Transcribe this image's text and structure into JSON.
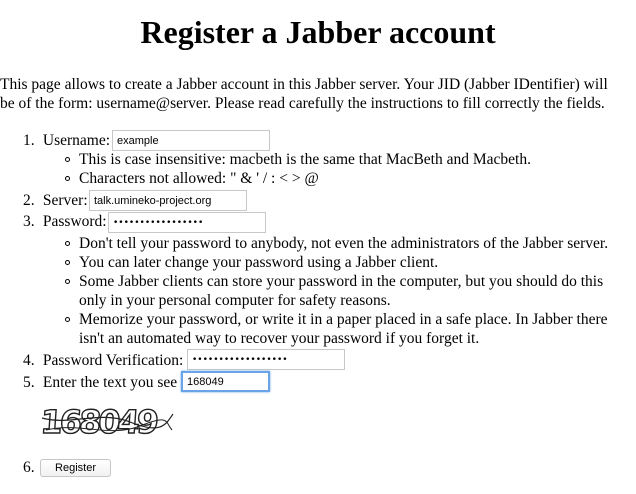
{
  "heading": "Register a Jabber account",
  "intro": {
    "line1": "This page allows to create a Jabber account in this Jabber server. Your JID (Jabber IDentifier) will",
    "line2": "be of the form: username@server. Please read carefully the instructions to fill correctly the fields."
  },
  "fields": {
    "username": {
      "number": "1.",
      "label": "Username:",
      "value": "example",
      "notes": [
        "This is case insensitive: macbeth is the same that MacBeth and Macbeth.",
        "Characters not allowed: \" & ' / : < > @"
      ]
    },
    "server": {
      "number": "2.",
      "label": "Server:",
      "value": "talk.umineko-project.org"
    },
    "password": {
      "number": "3.",
      "label": "Password:",
      "value": "•••••••••••••••••",
      "notes": [
        "Don't tell your password to anybody, not even the administrators of the Jabber server.",
        "You can later change your password using a Jabber client.",
        "Some Jabber clients can store your password in the computer, but you should do this",
        "only in your personal computer for safety reasons.",
        "Memorize your password, or write it in a paper placed in a safe place. In Jabber there",
        "isn't an automated way to recover your password if you forget it."
      ]
    },
    "password_verify": {
      "number": "4.",
      "label": "Password Verification:",
      "value": "••••••••••••••••••"
    },
    "captcha": {
      "number": "5.",
      "label": "Enter the text you see",
      "value": "168049",
      "image_text": "168049"
    },
    "submit": {
      "number": "6.",
      "label": "Register"
    }
  }
}
